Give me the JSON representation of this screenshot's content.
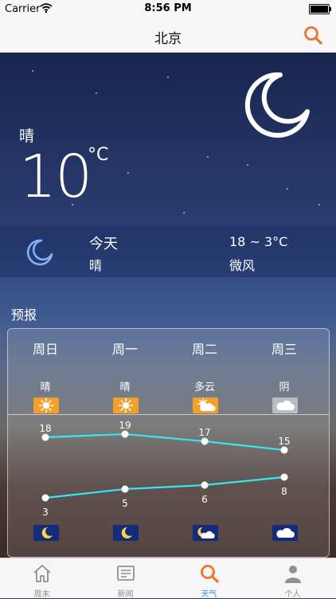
{
  "status": {
    "carrier": "Carrier",
    "time": "8:56 PM"
  },
  "nav": {
    "title": "北京"
  },
  "current": {
    "condition": "晴",
    "temp": "10",
    "unit": "°C"
  },
  "today": {
    "label": "今天",
    "condition": "晴",
    "range": "18 ~ 3°C",
    "wind": "微风"
  },
  "forecast": {
    "title": "预报",
    "days": [
      {
        "name": "周日",
        "cond": "晴",
        "high": "18",
        "low": "3"
      },
      {
        "name": "周一",
        "cond": "晴",
        "high": "19",
        "low": "5"
      },
      {
        "name": "周二",
        "cond": "多云",
        "high": "17",
        "low": "6"
      },
      {
        "name": "周三",
        "cond": "阴",
        "high": "15",
        "low": "8"
      }
    ]
  },
  "tabs": [
    {
      "label": "周末"
    },
    {
      "label": "新闻"
    },
    {
      "label": "天气"
    },
    {
      "label": "个人"
    }
  ],
  "colors": {
    "accent": "#2f8cff",
    "search": "#f0722a",
    "line": "#35e6f0"
  }
}
